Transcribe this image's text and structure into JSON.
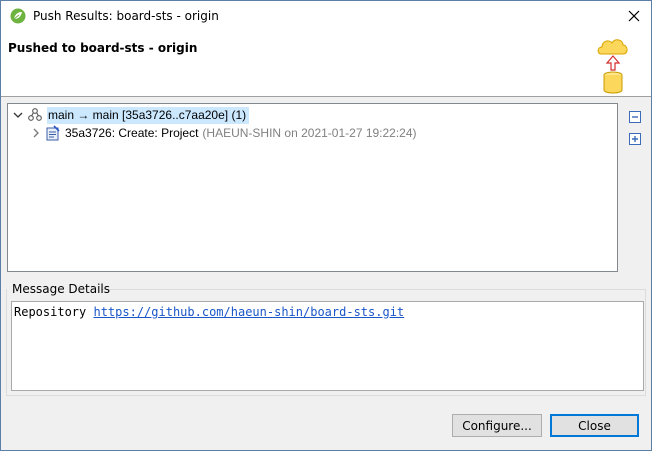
{
  "window": {
    "title": "Push Results: board-sts - origin"
  },
  "header": {
    "title": "Pushed to board-sts - origin"
  },
  "tree": {
    "branch_row": {
      "text": "main → main [35a3726..c7aa20e] (1)"
    },
    "commit_row": {
      "text": "35a3726: Create: Project",
      "meta": "(HAEUN-SHIN on 2021-01-27 19:22:24)"
    }
  },
  "message_details": {
    "label": "Message Details",
    "repository_label": "Repository",
    "repository_url": "https://github.com/haeun-shin/board-sts.git"
  },
  "buttons": {
    "configure": "Configure...",
    "close": "Close"
  },
  "icons": {
    "app": "spring-leaf-icon",
    "close": "close-icon",
    "header": "push-cloud-database-icon",
    "branch": "branch-icon",
    "commit": "commit-icon",
    "collapse_all": "collapse-all-icon",
    "expand_all": "expand-all-icon"
  },
  "colors": {
    "selection": "#cce8ff",
    "link": "#1a56c8",
    "default_button_border": "#0078d7"
  }
}
